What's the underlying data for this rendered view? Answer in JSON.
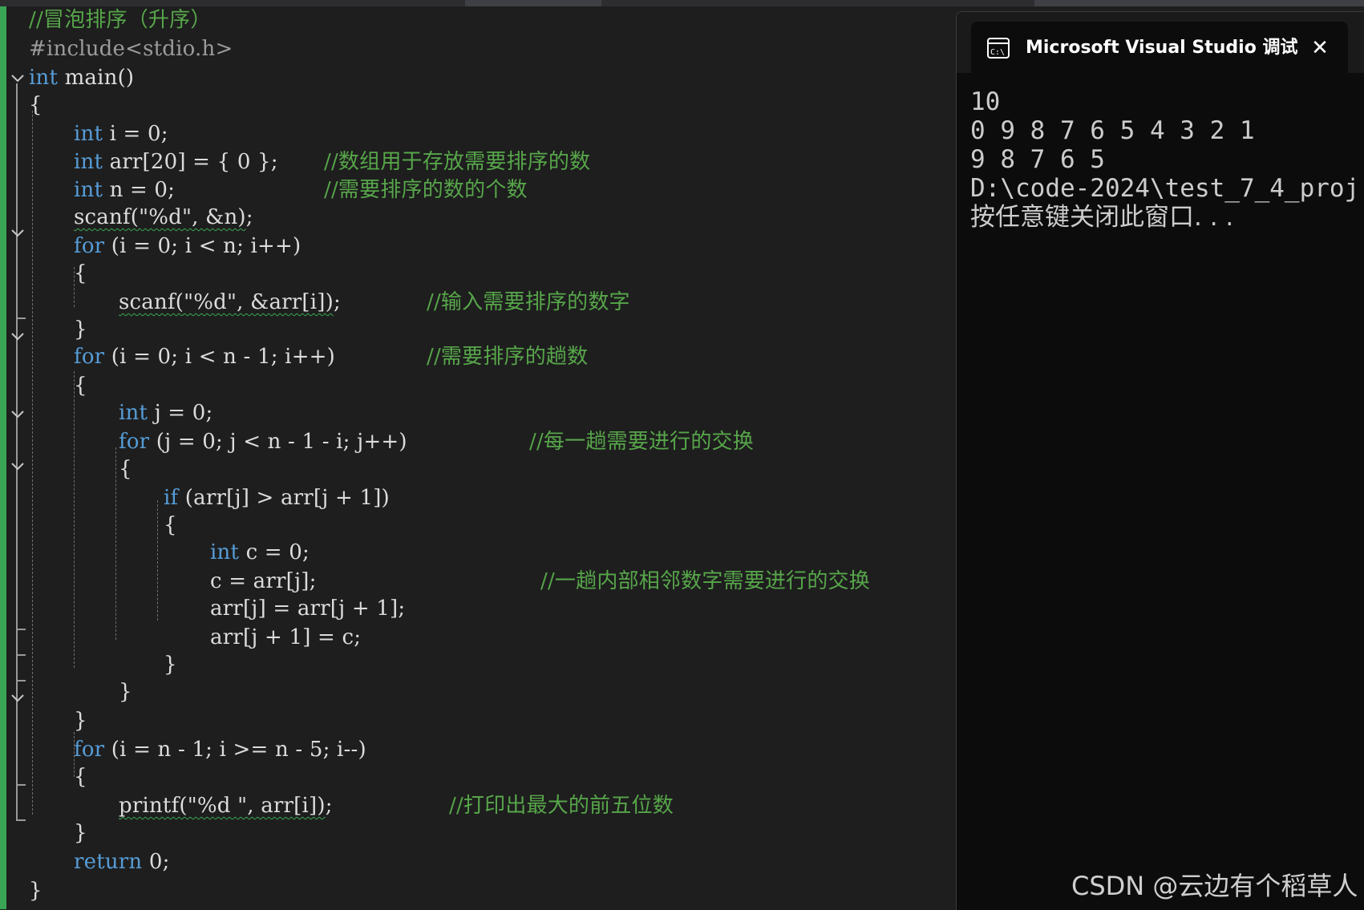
{
  "editor": {
    "lines": {
      "l1": {
        "cmt": "//冒泡排序（升序）"
      },
      "l2": {
        "pre": "#include<stdio.h>"
      },
      "l3": {
        "kw": "int",
        "rest": " main()"
      },
      "l4": {
        "text": "{"
      },
      "l5": {
        "kw": "int",
        "rest": " i = 0;"
      },
      "l6": {
        "kw": "int",
        "code": " arr[20] = { 0 };",
        "cmt": "//数组用于存放需要排序的数"
      },
      "l7": {
        "kw": "int",
        "code": " n = 0;",
        "cmt": "//需要排序的数的个数"
      },
      "l8": {
        "squig": "scanf(\"%d\", &n)",
        "rest": ";"
      },
      "l9": {
        "kw": "for",
        "rest": " (i = 0; i < n; i++)"
      },
      "l10": {
        "text": "{"
      },
      "l11": {
        "squig": "scanf(\"%d\", &arr[i])",
        "code": ";",
        "cmt": "//输入需要排序的数字"
      },
      "l12": {
        "text": "}"
      },
      "l13": {
        "kw": "for",
        "code": " (i = 0; i < n - 1; i++)",
        "cmt": "//需要排序的趟数"
      },
      "l14": {
        "text": "{"
      },
      "l15": {
        "kw": "int",
        "rest": " j = 0;"
      },
      "l16": {
        "kw": "for",
        "code": " (j = 0; j < n - 1 - i; j++)",
        "cmt": "//每一趟需要进行的交换"
      },
      "l17": {
        "text": "{"
      },
      "l18": {
        "kw": "if",
        "rest": " (arr[j] > arr[j + 1])"
      },
      "l19": {
        "text": "{"
      },
      "l20": {
        "kw": "int",
        "rest": " c = 0;"
      },
      "l21": {
        "code": "c = arr[j];",
        "cmt": "//一趟内部相邻数字需要进行的交换"
      },
      "l22": {
        "text": "arr[j] = arr[j + 1];"
      },
      "l23": {
        "text": "arr[j + 1] = c;"
      },
      "l24": {
        "text": "}"
      },
      "l25": {
        "text": "}"
      },
      "l26": {
        "text": "}"
      },
      "l27": {
        "kw": "for",
        "rest": " (i = n - 1; i >= n - 5; i--)"
      },
      "l28": {
        "text": "{"
      },
      "l29": {
        "squig": "printf(\"%d \", arr[i])",
        "code": ";",
        "cmt": "//打印出最大的前五位数"
      },
      "l30": {
        "text": "}"
      },
      "l31": {
        "kw": "return",
        "rest": " 0;"
      },
      "l32": {
        "text": "}"
      }
    },
    "fold_icon": "chevron-down-icon"
  },
  "console": {
    "title": "Microsoft Visual Studio 调试控制台",
    "icon": "terminal-icon",
    "close_icon": "close-icon",
    "close_glyph": "✕",
    "output": [
      "10",
      "0 9 8 7 6 5 4 3 2 1",
      "9 8 7 6 5",
      "D:\\code-2024\\test_7_4_proj",
      "按任意键关闭此窗口. . ."
    ]
  },
  "watermark": "CSDN @云边有个稻草人",
  "colors": {
    "keyword": "#569cd6",
    "comment": "#57a64a",
    "text": "#dcdcdc",
    "preprocessor": "#9b9b9b",
    "change_bar": "#3aa655",
    "console_bg": "#0c0c0c"
  }
}
